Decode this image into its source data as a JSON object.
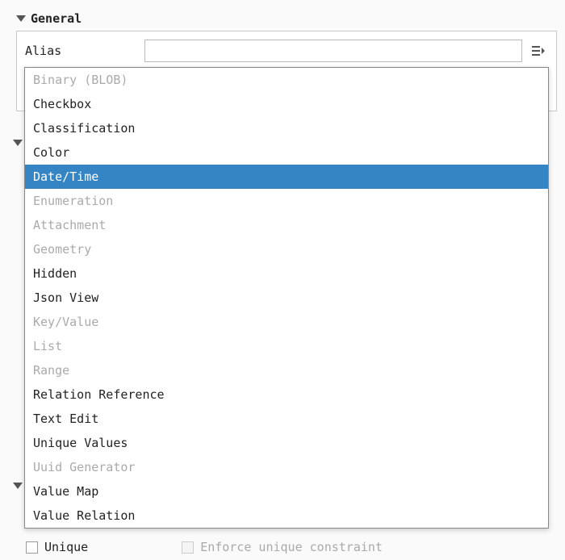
{
  "sections": {
    "general": {
      "title": "General"
    },
    "hidden1": {
      "title": ""
    },
    "hidden2": {
      "title": ""
    }
  },
  "fields": {
    "alias": {
      "label": "Alias",
      "value": ""
    }
  },
  "dropdown": {
    "items": [
      {
        "label": "Binary (BLOB)",
        "enabled": false,
        "selected": false
      },
      {
        "label": "Checkbox",
        "enabled": true,
        "selected": false
      },
      {
        "label": "Classification",
        "enabled": true,
        "selected": false
      },
      {
        "label": "Color",
        "enabled": true,
        "selected": false
      },
      {
        "label": "Date/Time",
        "enabled": true,
        "selected": true
      },
      {
        "label": "Enumeration",
        "enabled": false,
        "selected": false
      },
      {
        "label": "Attachment",
        "enabled": false,
        "selected": false
      },
      {
        "label": "Geometry",
        "enabled": false,
        "selected": false
      },
      {
        "label": "Hidden",
        "enabled": true,
        "selected": false
      },
      {
        "label": "Json View",
        "enabled": true,
        "selected": false
      },
      {
        "label": "Key/Value",
        "enabled": false,
        "selected": false
      },
      {
        "label": "List",
        "enabled": false,
        "selected": false
      },
      {
        "label": "Range",
        "enabled": false,
        "selected": false
      },
      {
        "label": "Relation Reference",
        "enabled": true,
        "selected": false
      },
      {
        "label": "Text Edit",
        "enabled": true,
        "selected": false
      },
      {
        "label": "Unique Values",
        "enabled": true,
        "selected": false
      },
      {
        "label": "Uuid Generator",
        "enabled": false,
        "selected": false
      },
      {
        "label": "Value Map",
        "enabled": true,
        "selected": false
      },
      {
        "label": "Value Relation",
        "enabled": true,
        "selected": false
      }
    ]
  },
  "constraints": {
    "unique": {
      "label": "Unique",
      "checked": false,
      "enabled": true
    },
    "enforce": {
      "label": "Enforce unique constraint",
      "checked": false,
      "enabled": false
    }
  }
}
